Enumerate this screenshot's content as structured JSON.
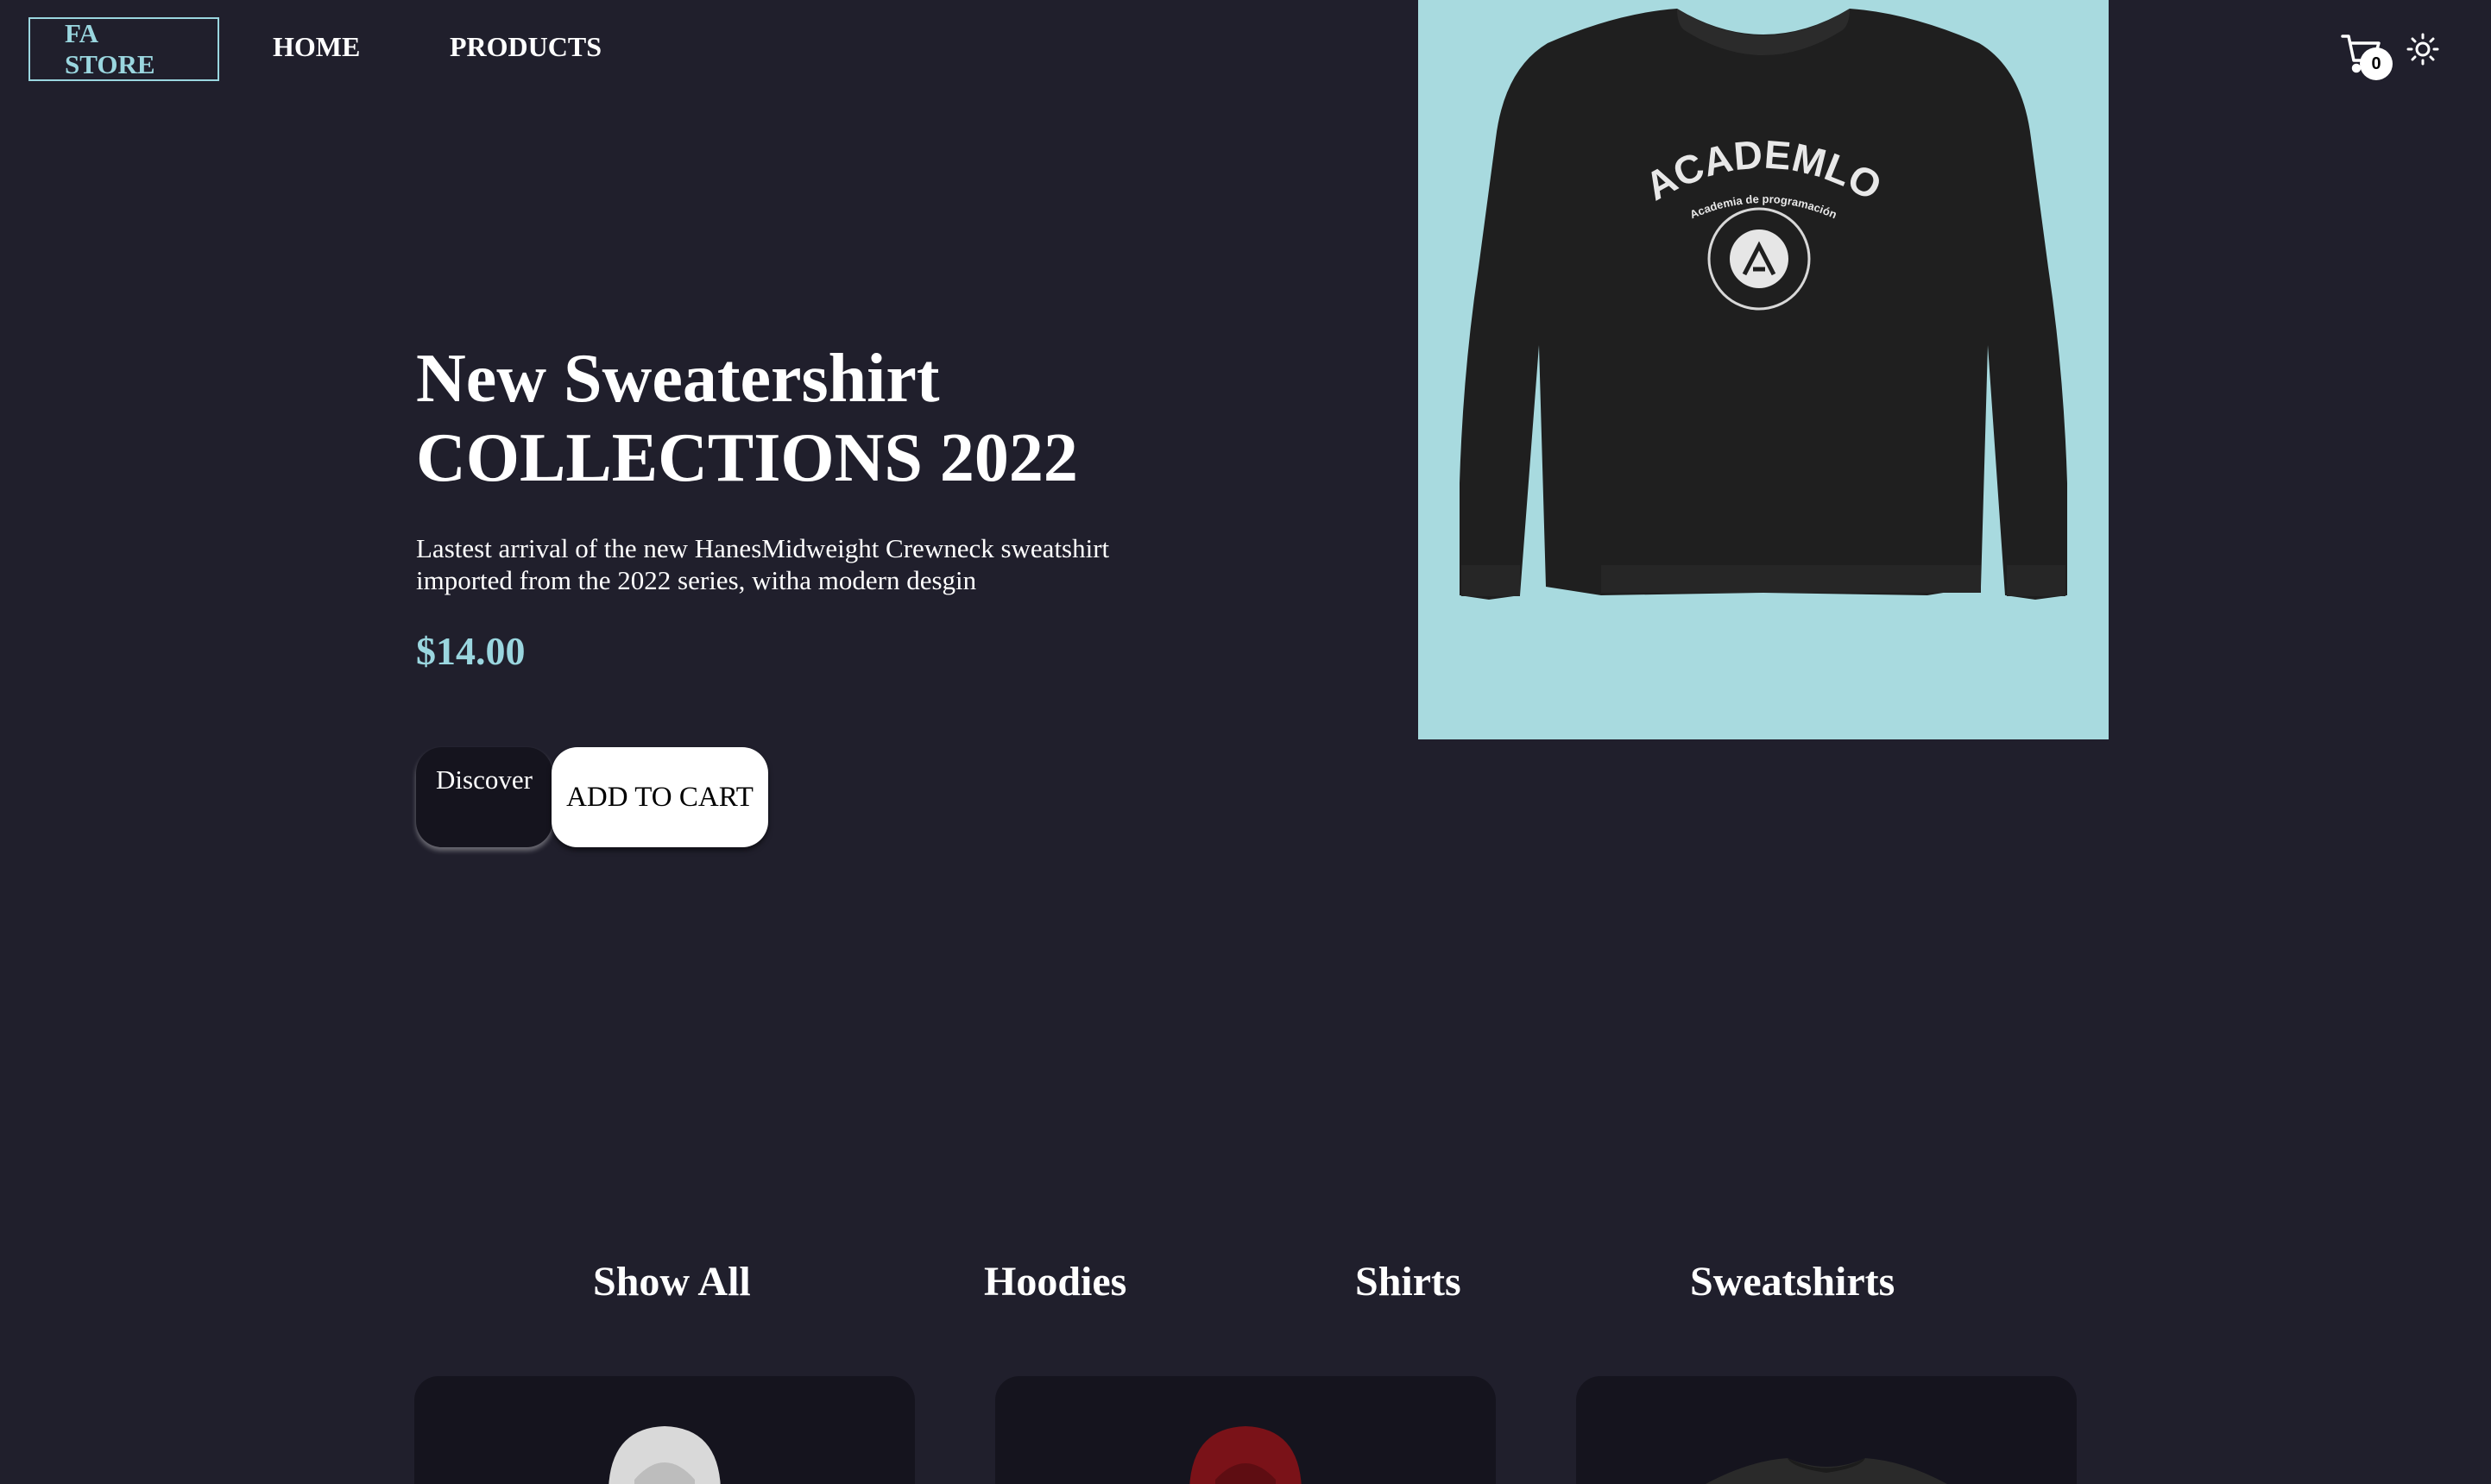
{
  "header": {
    "logo": {
      "line1": "FA",
      "line2": "STORE"
    },
    "nav": {
      "home": "HOME",
      "products": "PRODUCTS"
    },
    "cart": {
      "icon": "cart-icon",
      "count": "0"
    },
    "theme_toggle": {
      "icon": "sun-icon"
    }
  },
  "hero": {
    "title_line1": "New Sweatershirt",
    "title_line2": "COLLECTIONS 2022",
    "description_line1": "Lastest arrival of the new HanesMidweight Crewneck sweatshirt",
    "description_line2": "imported from the 2022 series, witha modern desgin",
    "price": "$14.00",
    "discover_label": "Discover",
    "add_to_cart_label": "ADD TO CART",
    "image": {
      "background_color": "#a8dadf",
      "print_text": "ACADEMLO",
      "print_subtext": "Academia de programación"
    }
  },
  "filters": {
    "tabs": [
      {
        "label": "Show All"
      },
      {
        "label": "Hoodies"
      },
      {
        "label": "Shirts"
      },
      {
        "label": "Sweatshirts"
      }
    ]
  },
  "products": [
    {
      "garment_color": "#d9d9d9"
    },
    {
      "garment_color": "#7a1218"
    },
    {
      "garment_color": "#2a2a2a"
    }
  ],
  "colors": {
    "background": "#201f2c",
    "accent": "#9ad6df",
    "card": "#15141e"
  }
}
